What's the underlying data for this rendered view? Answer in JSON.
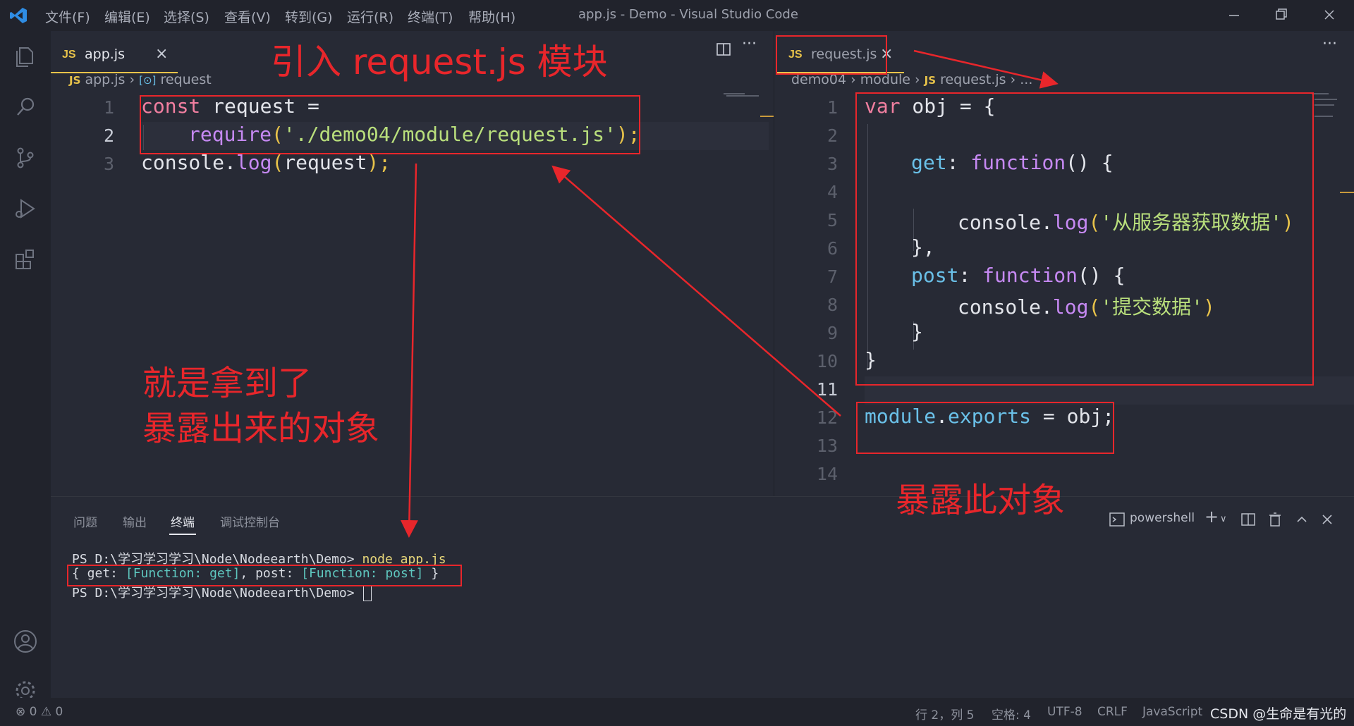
{
  "window": {
    "menu": [
      "文件(F)",
      "编辑(E)",
      "选择(S)",
      "查看(V)",
      "转到(G)",
      "运行(R)",
      "终端(T)",
      "帮助(H)"
    ],
    "title": "app.js - Demo - Visual Studio Code"
  },
  "left_editor": {
    "tab": {
      "badge": "JS",
      "label": "app.js",
      "close": "×"
    },
    "breadcrumb": {
      "badge": "JS",
      "file": "app.js",
      "sep": "›",
      "symbol_icon": "[⊙]",
      "symbol": "request"
    },
    "line_numbers": [
      "1",
      "2",
      "3"
    ],
    "code": {
      "l1_kw": "const",
      "l1_var": " request",
      "l1_op": " =",
      "l2_fn": "require",
      "l2_p1": "(",
      "l2_str": "'./demo04/module/request.js'",
      "l2_p2": ");",
      "l3_obj": "console",
      "l3_dot": ".",
      "l3_fn": "log",
      "l3_p1": "(",
      "l3_arg": "request",
      "l3_p2": ");"
    }
  },
  "right_editor": {
    "tab": {
      "badge": "JS",
      "label": "request.js",
      "close": "×"
    },
    "breadcrumb": {
      "d1": "demo04",
      "d2": "module",
      "badge": "JS",
      "file": "request.js",
      "tail": "..."
    },
    "line_numbers": [
      "1",
      "2",
      "3",
      "4",
      "5",
      "6",
      "7",
      "8",
      "9",
      "10",
      "11",
      "12",
      "13",
      "14"
    ],
    "code": {
      "l1_kw": "var",
      "l1_var": " obj",
      "l1_rest": " = {",
      "l3_prop": "get",
      "l3_colon": ": ",
      "l3_kw": "function",
      "l3_rest": "() {",
      "l5_obj": "console",
      "l5_dot": ".",
      "l5_fn": "log",
      "l5_p1": "(",
      "l5_str": "'从服务器获取数据'",
      "l5_p2": ")",
      "l6": "},",
      "l7_prop": "post",
      "l7_colon": ": ",
      "l7_kw": "function",
      "l7_rest": "() {",
      "l8_obj": "console",
      "l8_dot": ".",
      "l8_fn": "log",
      "l8_p1": "(",
      "l8_str": "'提交数据'",
      "l8_p2": ")",
      "l9": "}",
      "l10": "}",
      "l12_obj": "module",
      "l12_dot": ".",
      "l12_prop": "exports",
      "l12_op": " = ",
      "l12_var": "obj",
      "l12_end": ";"
    }
  },
  "panel": {
    "tabs": [
      "问题",
      "输出",
      "终端",
      "调试控制台"
    ],
    "active_tab": "终端",
    "shell": "powershell",
    "terminal": {
      "prompt": "PS D:\\学习学习学习\\Node\\Nodeearth\\Demo> ",
      "cmd": "node app.js",
      "out_1": "{ get: ",
      "out_fn1": "[Function: get]",
      "out_2": ", post: ",
      "out_fn2": "[Function: post]",
      "out_3": " }"
    }
  },
  "statusbar": {
    "errors": "0",
    "warnings": "0",
    "position": "行 2，列 5",
    "spaces": "空格: 4",
    "encoding": "UTF-8",
    "eol": "CRLF",
    "language": "JavaScript",
    "watermark": "CSDN @生命是有光的"
  },
  "annotations": {
    "title": "引入 request.js 模块",
    "got_line1": "就是拿到了",
    "got_line2": "暴露出来的对象",
    "expose": "暴露此对象"
  },
  "colors": {
    "annotation": "#e8262b",
    "js_badge": "#e8c34a",
    "accent": "#2f8de4"
  }
}
